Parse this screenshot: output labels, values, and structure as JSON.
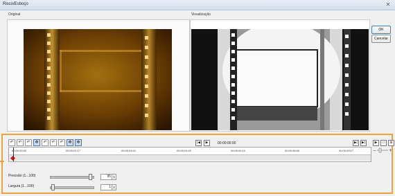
{
  "window": {
    "title": "Risco/Esboço",
    "close_icon": "close-icon"
  },
  "panels": {
    "original_label": "Original",
    "preview_label": "Visualização"
  },
  "buttons": {
    "ok": "OK",
    "cancel": "Cancelar"
  },
  "toolbar": {
    "tools": [
      "↶",
      "↶",
      "↶",
      "✥",
      "↶",
      "↶",
      "↶",
      "✥",
      "✥"
    ],
    "active_tool_indices": [
      3,
      7,
      8
    ]
  },
  "preview_controls": {
    "timecode": "00:00:00:00",
    "prev": "|◀",
    "play": "▶"
  },
  "right_controls": {
    "r1": "▶|",
    "r2": "▶|",
    "r3": "▶",
    "r4": "▭",
    "r5": "⊞"
  },
  "timeline": {
    "ticks": [
      "00:00:00:00",
      "00:00:01:17",
      "00:00:03:01",
      "00:00:04:20",
      "00:00:06:10",
      "00:00:08:00",
      "00:00:09:17"
    ]
  },
  "params": [
    {
      "label": "Precisão (1...100)",
      "value": "95",
      "fraction": 0.95
    },
    {
      "label": "Largura (1...100)",
      "value": "1",
      "fraction": 0.01
    }
  ]
}
